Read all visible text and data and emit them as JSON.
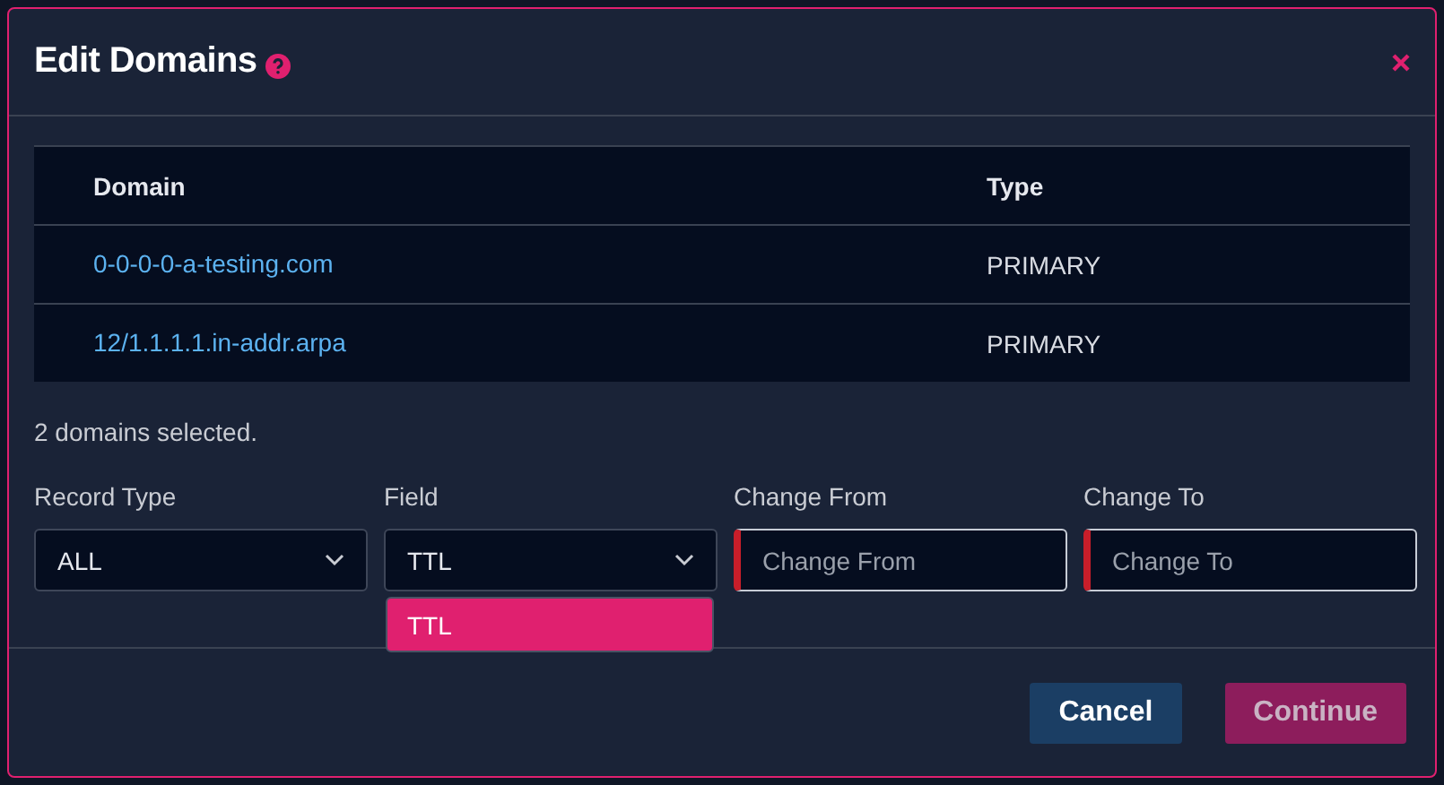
{
  "dialog": {
    "title": "Edit Domains"
  },
  "table": {
    "columns": [
      "Domain",
      "Type"
    ],
    "rows": [
      {
        "domain": "0-0-0-0-a-testing.com",
        "type": "PRIMARY"
      },
      {
        "domain": "12/1.1.1.1.in-addr.arpa",
        "type": "PRIMARY"
      }
    ]
  },
  "selection_note": "2 domains selected.",
  "fields": [
    {
      "kind": "select",
      "label": "Record Type",
      "value": "ALL"
    },
    {
      "kind": "select",
      "label": "Field",
      "value": "TTL",
      "expanded": true,
      "options": [
        {
          "label": "TTL",
          "selected": true
        }
      ]
    },
    {
      "kind": "input",
      "label": "Change From",
      "placeholder": "Change From",
      "invalid": true
    },
    {
      "kind": "input",
      "label": "Change To",
      "placeholder": "Change To",
      "invalid": true
    }
  ],
  "buttons": [
    {
      "label": "Cancel",
      "kind": "secondary",
      "disabled": false
    },
    {
      "label": "Continue",
      "kind": "primary",
      "disabled": true
    }
  ]
}
